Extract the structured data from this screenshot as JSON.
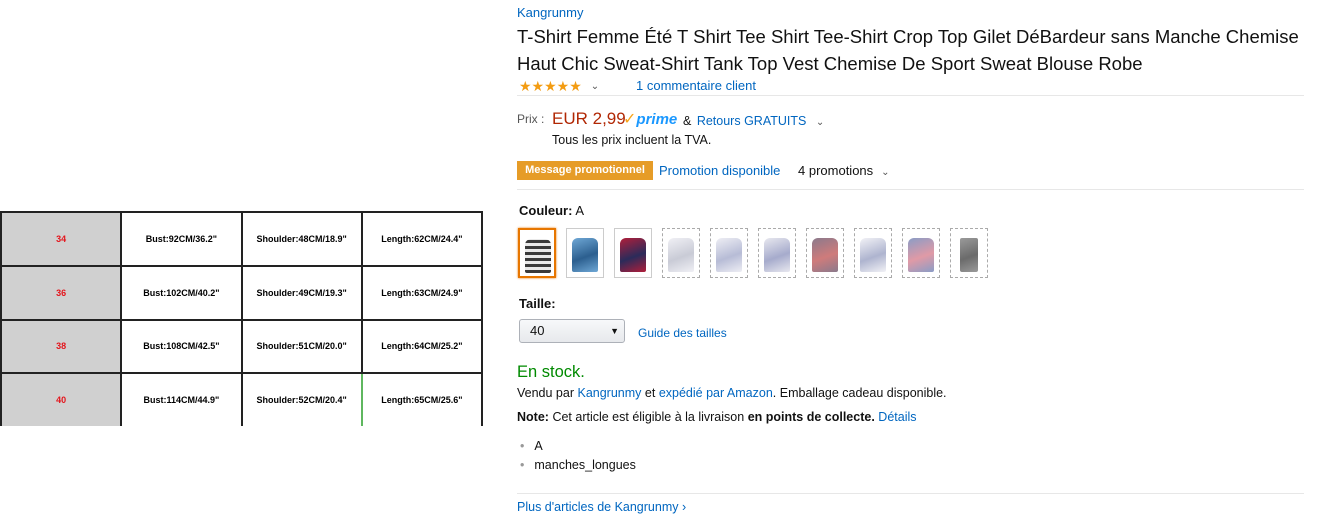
{
  "size_table": {
    "rows": [
      {
        "size": "34",
        "bust": "Bust:92CM/36.2\"",
        "shoulder": "Shoulder:48CM/18.9\"",
        "length": "Length:62CM/24.4\""
      },
      {
        "size": "36",
        "bust": "Bust:102CM/40.2\"",
        "shoulder": "Shoulder:49CM/19.3\"",
        "length": "Length:63CM/24.9\""
      },
      {
        "size": "38",
        "bust": "Bust:108CM/42.5\"",
        "shoulder": "Shoulder:51CM/20.0\"",
        "length": "Length:64CM/25.2\""
      },
      {
        "size": "40",
        "bust": "Bust:114CM/44.9\"",
        "shoulder": "Shoulder:52CM/20.4\"",
        "length": "Length:65CM/25.6\""
      }
    ]
  },
  "product": {
    "brand": "Kangrunmy",
    "title": "T-Shirt Femme Été T Shirt Tee Shirt Tee-Shirt Crop Top Gilet DéBardeur sans Manche Chemise Haut Chic Sweat-Shirt Tank Top Vest Chemise De Sport Sweat Blouse Robe",
    "stars": "★★★★★",
    "rating_value": 5,
    "reviews": "1 commentaire client"
  },
  "price": {
    "label": "Prix :",
    "value": "EUR 2,99",
    "prime_check": "✓",
    "prime": "prime",
    "amp": "&",
    "returns": "Retours GRATUITS",
    "vat": "Tous les prix incluent la TVA."
  },
  "promo": {
    "badge": "Message promotionnel",
    "link": "Promotion disponible",
    "count": "4 promotions"
  },
  "color": {
    "label": "Couleur:",
    "value": "A",
    "swatches": [
      {
        "color": "#3a3a3a",
        "accent": "#e9e9e9",
        "selected": true,
        "available": true
      },
      {
        "color": "#2c5f8f",
        "accent": "#6fa8d6",
        "selected": false,
        "available": true
      },
      {
        "color": "#2b2b5a",
        "accent": "#b01e3a",
        "selected": false,
        "available": true
      },
      {
        "color": "#c9cbd6",
        "accent": "#f0f0f5",
        "selected": false,
        "available": false
      },
      {
        "color": "#b7bcd6",
        "accent": "#eeeef4",
        "selected": false,
        "available": false
      },
      {
        "color": "#a6abcc",
        "accent": "#e8e8ef",
        "selected": false,
        "available": false
      },
      {
        "color": "#cf7b7b",
        "accent": "#8b7a8c",
        "selected": false,
        "available": false
      },
      {
        "color": "#aeb4cf",
        "accent": "#f2f2f6",
        "selected": false,
        "available": false
      },
      {
        "color": "#e09aa6",
        "accent": "#8a9cc6",
        "selected": false,
        "available": false
      },
      {
        "color": "#6b6b6b",
        "accent": "#9a9a9a",
        "selected": false,
        "available": false
      }
    ]
  },
  "size": {
    "label": "Taille:",
    "selected": "40",
    "guide": "Guide des tailles"
  },
  "availability": {
    "stock": "En stock.",
    "sold_prefix": "Vendu par",
    "seller": "Kangrunmy",
    "sold_mid": "et",
    "shipped": "expédié par Amazon",
    "sold_suffix": ". Emballage cadeau disponible.",
    "note_label": "Note:",
    "note_text": "Cet article est éligible à la livraison",
    "note_bold": "en points de collecte.",
    "details": "Détails"
  },
  "bullets": [
    "A",
    "manches_longues"
  ],
  "more_link": "Plus d'articles de Kangrunmy ›"
}
